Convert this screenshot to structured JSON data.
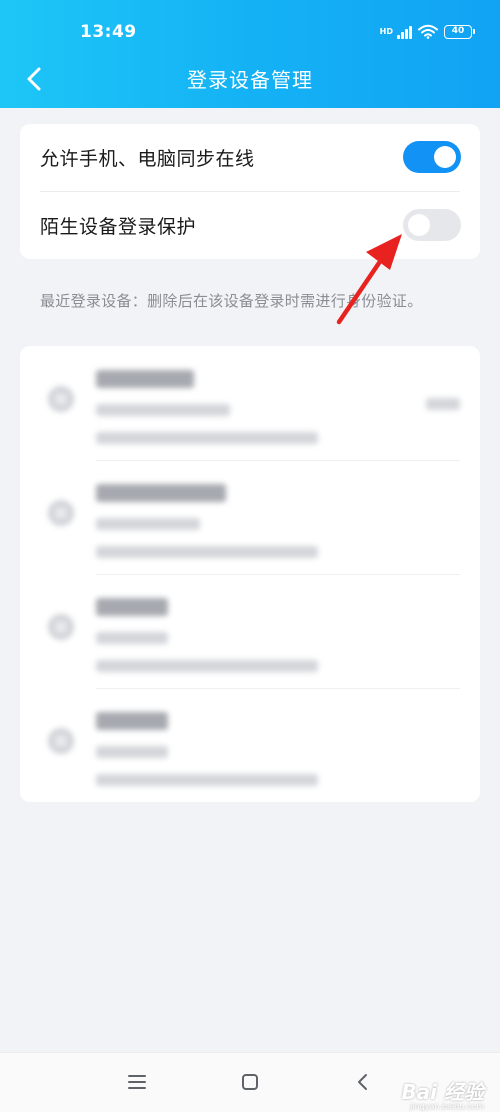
{
  "status": {
    "time": "13:49",
    "network": "HD",
    "battery": "40"
  },
  "header": {
    "title": "登录设备管理"
  },
  "settings": [
    {
      "label": "允许手机、电脑同步在线",
      "enabled": true
    },
    {
      "label": "陌生设备登录保护",
      "enabled": false
    }
  ],
  "hint": "最近登录设备：删除后在该设备登录时需进行身份验证。",
  "devices_blurred": 4,
  "watermark": {
    "logo": "Bai 经验",
    "url": "jingyan.baidu.com"
  },
  "colors": {
    "header": "#14b2f5",
    "toggle_on": "#1292f5",
    "toggle_off": "#e6e7ea",
    "annotation_arrow": "#e8231f"
  },
  "icons": [
    "back-arrow-icon",
    "signal-icon",
    "wifi-icon",
    "battery-icon",
    "menu-icon",
    "home-square-icon",
    "back-triangle-icon",
    "device-icon"
  ]
}
